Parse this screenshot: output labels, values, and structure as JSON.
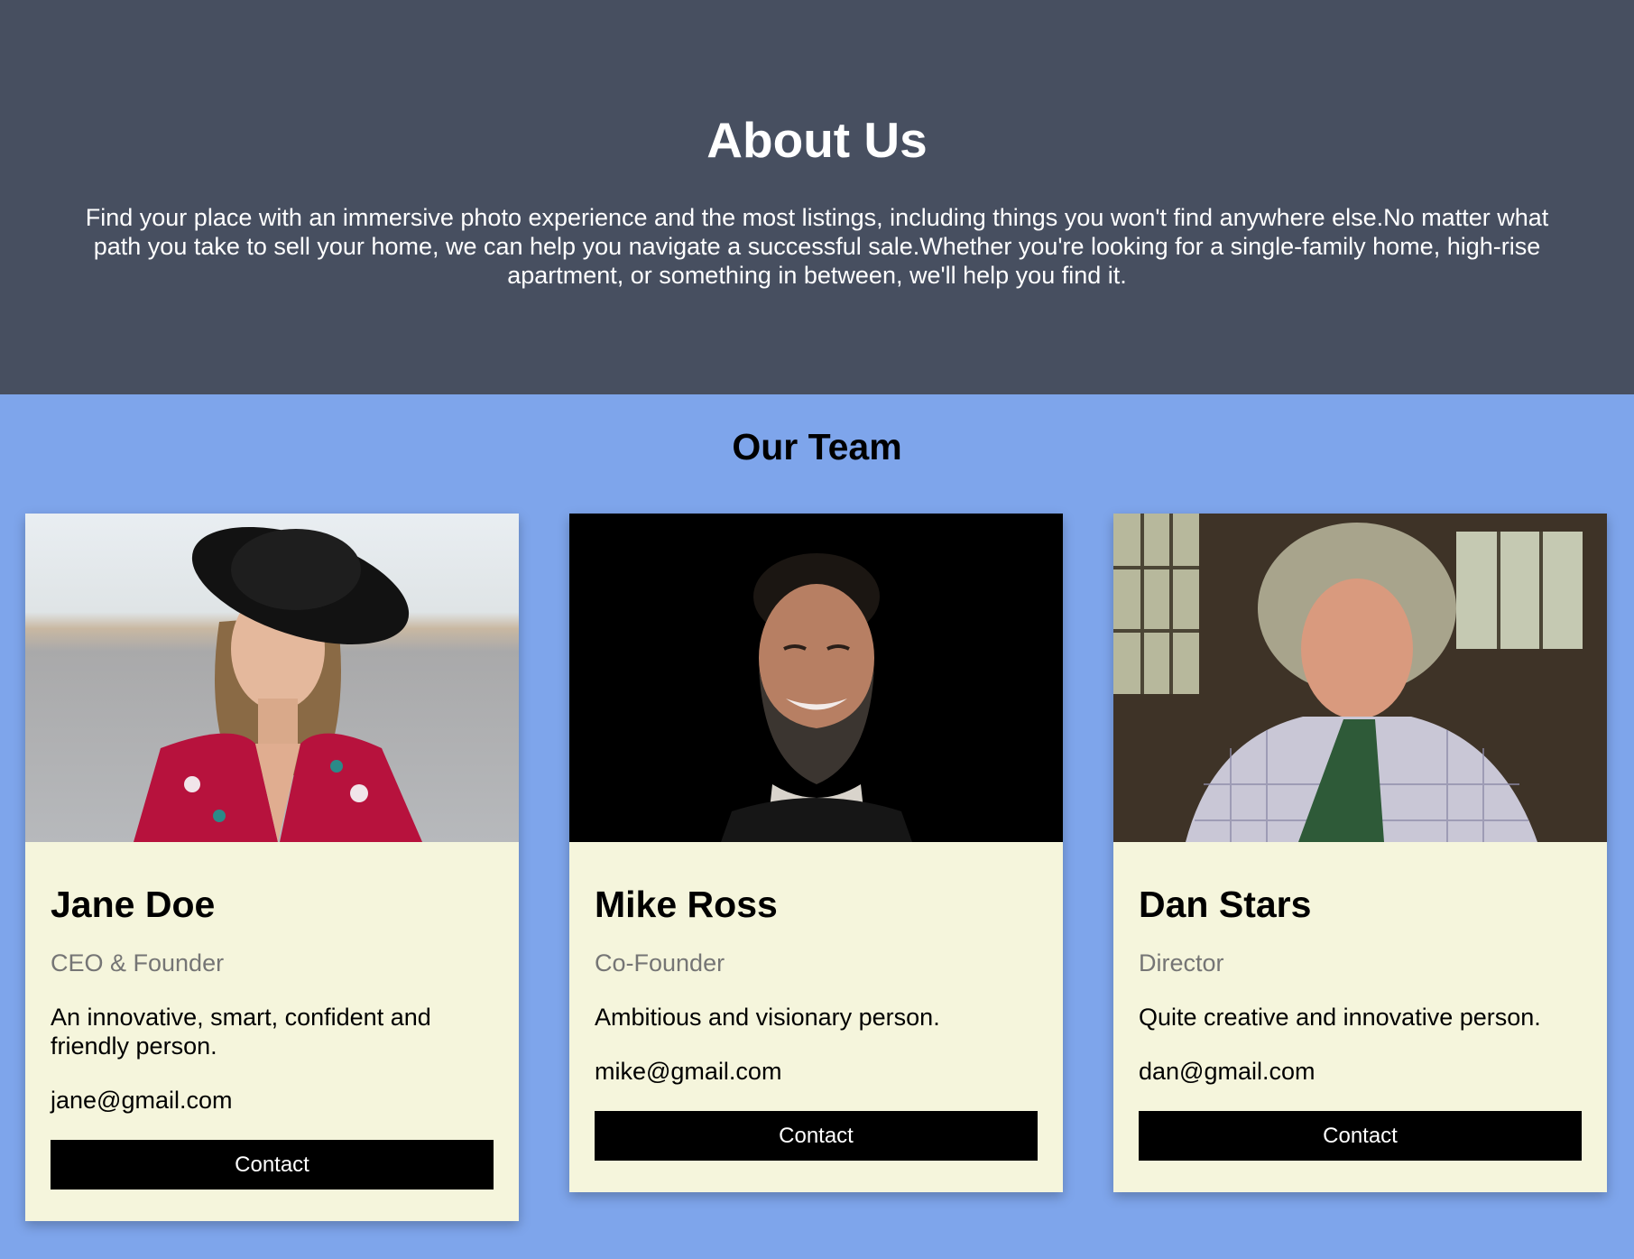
{
  "about": {
    "title": "About Us",
    "text": "Find your place with an immersive photo experience and the most listings, including things you won't find anywhere else.No matter what path you take to sell your home, we can help you navigate a successful sale.Whether you're looking for a single-family home, high-rise apartment, or something in between, we'll help you find it."
  },
  "team": {
    "title": "Our Team",
    "members": [
      {
        "name": "Jane Doe",
        "role": "CEO & Founder",
        "description": "An innovative, smart, confident and friendly person.",
        "email": "jane@gmail.com",
        "button_label": "Contact"
      },
      {
        "name": "Mike Ross",
        "role": "Co-Founder",
        "description": "Ambitious and visionary person.",
        "email": "mike@gmail.com",
        "button_label": "Contact"
      },
      {
        "name": "Dan Stars",
        "role": "Director",
        "description": "Quite creative and innovative person.",
        "email": "dan@gmail.com",
        "button_label": "Contact"
      }
    ]
  },
  "colors": {
    "header_bg": "#474f60",
    "page_bg": "#7ea5eb",
    "card_bg": "#f5f5dc",
    "button_bg": "#000000",
    "role_text": "#757575"
  }
}
